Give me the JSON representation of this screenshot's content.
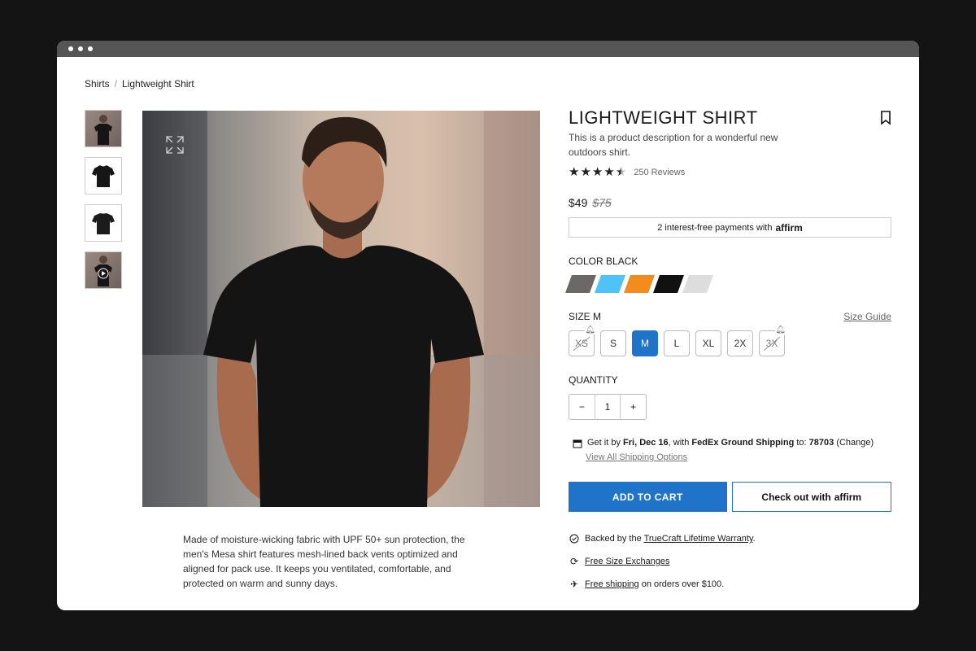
{
  "breadcrumb": {
    "home": "Shirts",
    "sep": "/",
    "current": "Lightweight Shirt"
  },
  "gallery": {
    "thumbs": [
      "model-front",
      "shirt-front",
      "shirt-back",
      "model-video"
    ]
  },
  "description": "Made of moisture-wicking fabric with UPF 50+ sun protection, the men's Mesa shirt features mesh-lined back vents optimized and aligned for pack use. It keeps you ventilated, comfortable, and protected on warm and sunny days.",
  "product": {
    "title": "LIGHTWEIGHT SHIRT",
    "subtitle": "This is a product description for a wonderful new outdoors shirt.",
    "rating": 4.5,
    "reviews": "250 Reviews",
    "price": "$49",
    "old_price": "$75",
    "affirm_text": "2 interest-free payments with",
    "affirm_brand": "affirm"
  },
  "color": {
    "label": "COLOR",
    "selected": "BLACK",
    "swatches": [
      "#6b6966",
      "#4fc3f7",
      "#f28c1e",
      "#111111",
      "#dddddd"
    ]
  },
  "size": {
    "label": "SIZE",
    "selected": "M",
    "guide": "Size Guide",
    "options": [
      "XS",
      "S",
      "M",
      "L",
      "XL",
      "2X",
      "3X"
    ]
  },
  "quantity": {
    "label": "QUANTITY",
    "value": "1",
    "minus": "−",
    "plus": "+"
  },
  "shipping": {
    "t1": "Get it by",
    "date": "Fri, Dec 16",
    "t2": ", with",
    "method": "FedEx Ground Shipping",
    "t3": "to:",
    "zip": "78703",
    "change": "(Change)",
    "options_link": "View All Shipping Options"
  },
  "cta": {
    "add_to_cart": "ADD TO CART",
    "checkout": "Check out with",
    "checkout_brand": "affirm"
  },
  "perks": {
    "warranty_pre": "Backed by the",
    "warranty_link": "TrueCraft Lifetime Warranty",
    "warranty_post": ".",
    "exchanges": "Free Size Exchanges",
    "free_shipping": "Free shipping",
    "free_shipping_post": "on orders over $100."
  }
}
